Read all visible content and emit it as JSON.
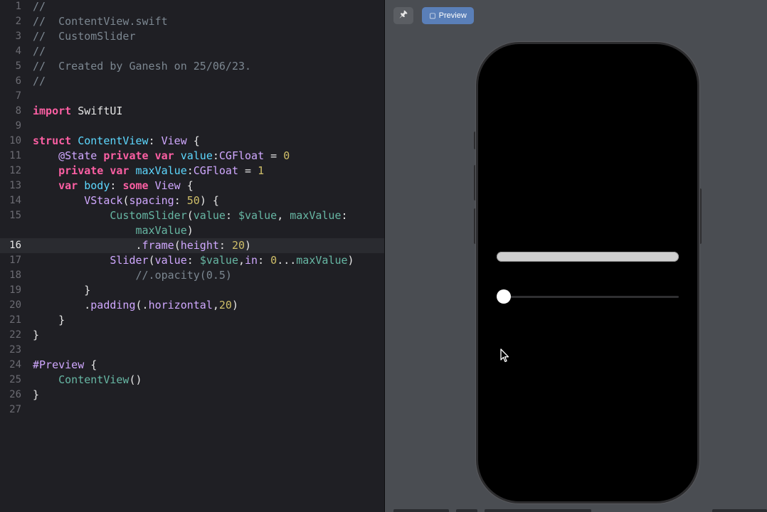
{
  "editor": {
    "current_line": 16,
    "lines": [
      {
        "num": "1",
        "tokens": [
          {
            "t": "//",
            "c": "comment"
          }
        ]
      },
      {
        "num": "2",
        "tokens": [
          {
            "t": "//  ContentView.swift",
            "c": "comment"
          }
        ]
      },
      {
        "num": "3",
        "tokens": [
          {
            "t": "//  CustomSlider",
            "c": "comment"
          }
        ]
      },
      {
        "num": "4",
        "tokens": [
          {
            "t": "//",
            "c": "comment"
          }
        ]
      },
      {
        "num": "5",
        "tokens": [
          {
            "t": "//  Created by Ganesh on 25/06/23.",
            "c": "comment"
          }
        ]
      },
      {
        "num": "6",
        "tokens": [
          {
            "t": "//",
            "c": "comment"
          }
        ]
      },
      {
        "num": "7",
        "tokens": []
      },
      {
        "num": "8",
        "tokens": [
          {
            "t": "import",
            "c": "kw"
          },
          {
            "t": " SwiftUI",
            "c": "plain"
          }
        ]
      },
      {
        "num": "9",
        "tokens": []
      },
      {
        "num": "10",
        "tokens": [
          {
            "t": "struct",
            "c": "kw"
          },
          {
            "t": " ",
            "c": "plain"
          },
          {
            "t": "ContentView",
            "c": "decl"
          },
          {
            "t": ": ",
            "c": "plain"
          },
          {
            "t": "View",
            "c": "type"
          },
          {
            "t": " {",
            "c": "plain"
          }
        ]
      },
      {
        "num": "11",
        "tokens": [
          {
            "t": "    @State",
            "c": "type"
          },
          {
            "t": " ",
            "c": "plain"
          },
          {
            "t": "private",
            "c": "kw"
          },
          {
            "t": " ",
            "c": "plain"
          },
          {
            "t": "var",
            "c": "kw"
          },
          {
            "t": " ",
            "c": "plain"
          },
          {
            "t": "value",
            "c": "decl"
          },
          {
            "t": ":",
            "c": "plain"
          },
          {
            "t": "CGFloat",
            "c": "type"
          },
          {
            "t": " = ",
            "c": "plain"
          },
          {
            "t": "0",
            "c": "num"
          }
        ]
      },
      {
        "num": "12",
        "tokens": [
          {
            "t": "    ",
            "c": "plain"
          },
          {
            "t": "private",
            "c": "kw"
          },
          {
            "t": " ",
            "c": "plain"
          },
          {
            "t": "var",
            "c": "kw"
          },
          {
            "t": " ",
            "c": "plain"
          },
          {
            "t": "maxValue",
            "c": "decl"
          },
          {
            "t": ":",
            "c": "plain"
          },
          {
            "t": "CGFloat",
            "c": "type"
          },
          {
            "t": " = ",
            "c": "plain"
          },
          {
            "t": "1",
            "c": "num"
          }
        ]
      },
      {
        "num": "13",
        "tokens": [
          {
            "t": "    ",
            "c": "plain"
          },
          {
            "t": "var",
            "c": "kw"
          },
          {
            "t": " ",
            "c": "plain"
          },
          {
            "t": "body",
            "c": "decl"
          },
          {
            "t": ": ",
            "c": "plain"
          },
          {
            "t": "some",
            "c": "kw"
          },
          {
            "t": " ",
            "c": "plain"
          },
          {
            "t": "View",
            "c": "type"
          },
          {
            "t": " {",
            "c": "plain"
          }
        ]
      },
      {
        "num": "14",
        "tokens": [
          {
            "t": "        ",
            "c": "plain"
          },
          {
            "t": "VStack",
            "c": "type"
          },
          {
            "t": "(",
            "c": "plain"
          },
          {
            "t": "spacing",
            "c": "type"
          },
          {
            "t": ": ",
            "c": "plain"
          },
          {
            "t": "50",
            "c": "num"
          },
          {
            "t": ") {",
            "c": "plain"
          }
        ]
      },
      {
        "num": "15",
        "tokens": [
          {
            "t": "            ",
            "c": "plain"
          },
          {
            "t": "CustomSlider",
            "c": "call"
          },
          {
            "t": "(",
            "c": "plain"
          },
          {
            "t": "value",
            "c": "call"
          },
          {
            "t": ": ",
            "c": "plain"
          },
          {
            "t": "$value",
            "c": "call"
          },
          {
            "t": ", ",
            "c": "plain"
          },
          {
            "t": "maxValue",
            "c": "call"
          },
          {
            "t": ":",
            "c": "plain"
          }
        ]
      },
      {
        "num": "",
        "tokens": [
          {
            "t": "                ",
            "c": "plain"
          },
          {
            "t": "maxValue",
            "c": "call"
          },
          {
            "t": ")",
            "c": "plain"
          }
        ]
      },
      {
        "num": "16",
        "tokens": [
          {
            "t": "                .",
            "c": "plain"
          },
          {
            "t": "frame",
            "c": "type"
          },
          {
            "t": "(",
            "c": "plain"
          },
          {
            "t": "height",
            "c": "type"
          },
          {
            "t": ": ",
            "c": "plain"
          },
          {
            "t": "20",
            "c": "num"
          },
          {
            "t": ")",
            "c": "plain"
          }
        ]
      },
      {
        "num": "17",
        "tokens": [
          {
            "t": "            ",
            "c": "plain"
          },
          {
            "t": "Slider",
            "c": "type"
          },
          {
            "t": "(",
            "c": "plain"
          },
          {
            "t": "value",
            "c": "type"
          },
          {
            "t": ": ",
            "c": "plain"
          },
          {
            "t": "$value",
            "c": "call"
          },
          {
            "t": ",",
            "c": "plain"
          },
          {
            "t": "in",
            "c": "type"
          },
          {
            "t": ": ",
            "c": "plain"
          },
          {
            "t": "0",
            "c": "num"
          },
          {
            "t": "...",
            "c": "plain"
          },
          {
            "t": "maxValue",
            "c": "call"
          },
          {
            "t": ")",
            "c": "plain"
          }
        ]
      },
      {
        "num": "18",
        "tokens": [
          {
            "t": "                //.opacity(0.5)",
            "c": "comment"
          }
        ]
      },
      {
        "num": "19",
        "tokens": [
          {
            "t": "        }",
            "c": "plain"
          }
        ]
      },
      {
        "num": "20",
        "tokens": [
          {
            "t": "        .",
            "c": "plain"
          },
          {
            "t": "padding",
            "c": "type"
          },
          {
            "t": "(.",
            "c": "plain"
          },
          {
            "t": "horizontal",
            "c": "type"
          },
          {
            "t": ",",
            "c": "plain"
          },
          {
            "t": "20",
            "c": "num"
          },
          {
            "t": ")",
            "c": "plain"
          }
        ]
      },
      {
        "num": "21",
        "tokens": [
          {
            "t": "    }",
            "c": "plain"
          }
        ]
      },
      {
        "num": "22",
        "tokens": [
          {
            "t": "}",
            "c": "plain"
          }
        ]
      },
      {
        "num": "23",
        "tokens": []
      },
      {
        "num": "24",
        "tokens": [
          {
            "t": "#Preview",
            "c": "type"
          },
          {
            "t": " {",
            "c": "plain"
          }
        ]
      },
      {
        "num": "25",
        "tokens": [
          {
            "t": "    ",
            "c": "plain"
          },
          {
            "t": "ContentView",
            "c": "call"
          },
          {
            "t": "()",
            "c": "plain"
          }
        ]
      },
      {
        "num": "26",
        "tokens": [
          {
            "t": "}",
            "c": "plain"
          }
        ]
      },
      {
        "num": "27",
        "tokens": []
      }
    ]
  },
  "canvas": {
    "pin_icon": "pin-icon",
    "preview_label": "Preview",
    "preview_icon": "device-icon"
  },
  "preview": {
    "custom_slider_value": 0,
    "slider_value": 0,
    "slider_max": 1
  },
  "colors": {
    "editor_bg": "#1f1f24",
    "canvas_bg": "#4a4d52",
    "preview_button": "#5a7fb8",
    "keyword": "#fc5fa3",
    "comment": "#7c8791",
    "number": "#d0bf69"
  }
}
